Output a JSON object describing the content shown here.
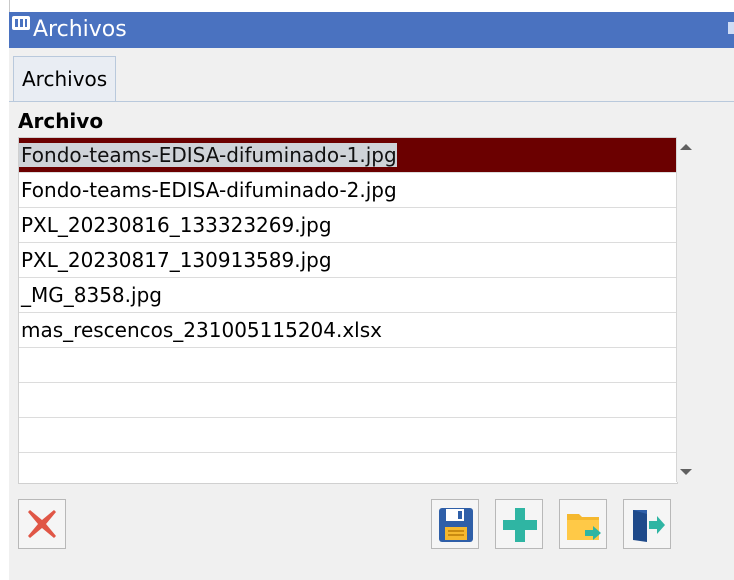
{
  "window": {
    "title": "Archivos"
  },
  "tabs": [
    {
      "label": "Archivos"
    }
  ],
  "list": {
    "header": "Archivo",
    "rows": [
      "Fondo-teams-EDISA-difuminado-1.jpg",
      "Fondo-teams-EDISA-difuminado-2.jpg",
      "PXL_20230816_133323269.jpg",
      "PXL_20230817_130913589.jpg",
      "_MG_8358.jpg",
      "mas_rescencos_231005115204.xlsx",
      "",
      "",
      "",
      ""
    ],
    "selected_index": 0
  },
  "toolbar": {
    "buttons": [
      {
        "name": "delete-button",
        "icon": "red-x-icon"
      },
      {
        "name": "save-button",
        "icon": "floppy-disk-icon"
      },
      {
        "name": "add-button",
        "icon": "plus-icon"
      },
      {
        "name": "open-folder-button",
        "icon": "folder-arrow-icon"
      },
      {
        "name": "exit-button",
        "icon": "door-exit-icon"
      }
    ]
  },
  "colors": {
    "titlebar": "#4a72c0",
    "selected_row": "#6b0000",
    "delete_red": "#e05646",
    "plus_teal": "#2fb5a3",
    "folder_yellow": "#f5b82e",
    "door_blue": "#2f5fa8"
  }
}
